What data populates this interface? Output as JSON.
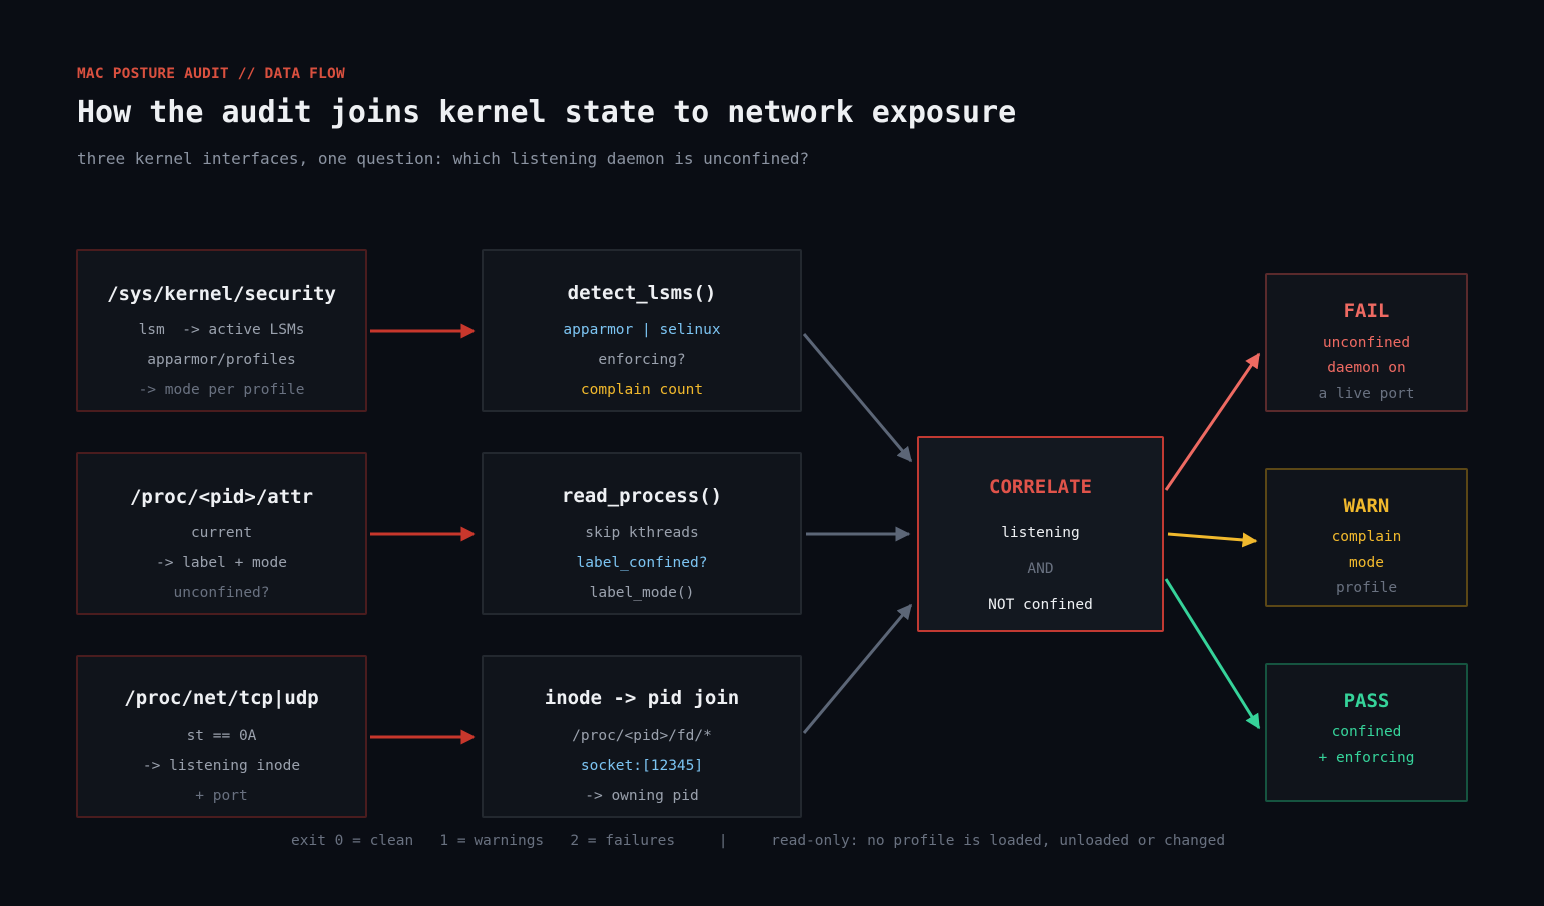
{
  "header": {
    "kicker": "MAC POSTURE AUDIT // DATA FLOW",
    "title": "How the audit joins kernel state to network exposure",
    "subtitle": "three kernel interfaces, one question: which listening daemon is unconfined?"
  },
  "sources": [
    {
      "title": "/sys/kernel/security",
      "lines": [
        "lsm  -> active LSMs",
        "apparmor/profiles",
        "-> mode per profile"
      ]
    },
    {
      "title": "/proc/<pid>/attr",
      "lines": [
        "current",
        "-> label + mode",
        "unconfined?"
      ]
    },
    {
      "title": "/proc/net/tcp|udp",
      "lines": [
        "st == 0A",
        "-> listening inode",
        "+ port"
      ]
    }
  ],
  "processors": [
    {
      "title": "detect_lsms()",
      "lines": [
        "apparmor | selinux",
        "enforcing?",
        "complain count"
      ]
    },
    {
      "title": "read_process()",
      "lines": [
        "skip kthreads",
        "label_confined?",
        "label_mode()"
      ]
    },
    {
      "title": "inode -> pid join",
      "lines": [
        "/proc/<pid>/fd/*",
        "socket:[12345]",
        "-> owning pid"
      ]
    }
  ],
  "correlate": {
    "title": "CORRELATE",
    "lines": [
      "listening",
      "AND",
      "NOT confined"
    ]
  },
  "outcomes": {
    "fail": {
      "title": "FAIL",
      "lines": [
        "unconfined",
        "daemon on",
        "a live port"
      ]
    },
    "warn": {
      "title": "WARN",
      "lines": [
        "complain",
        "mode",
        "profile"
      ]
    },
    "pass": {
      "title": "PASS",
      "lines": [
        "confined",
        "+ enforcing"
      ]
    }
  },
  "footer": "exit 0 = clean   1 = warnings   2 = failures     |     read-only: no profile is loaded, unloaded or changed",
  "colors": {
    "background": "#0a0d14",
    "accent_red": "#c23a33",
    "arrow_gray": "#5c6677",
    "fail": "#ee6a62",
    "warn": "#f1b92d",
    "pass": "#36d39a",
    "blue": "#7cc4f2"
  }
}
